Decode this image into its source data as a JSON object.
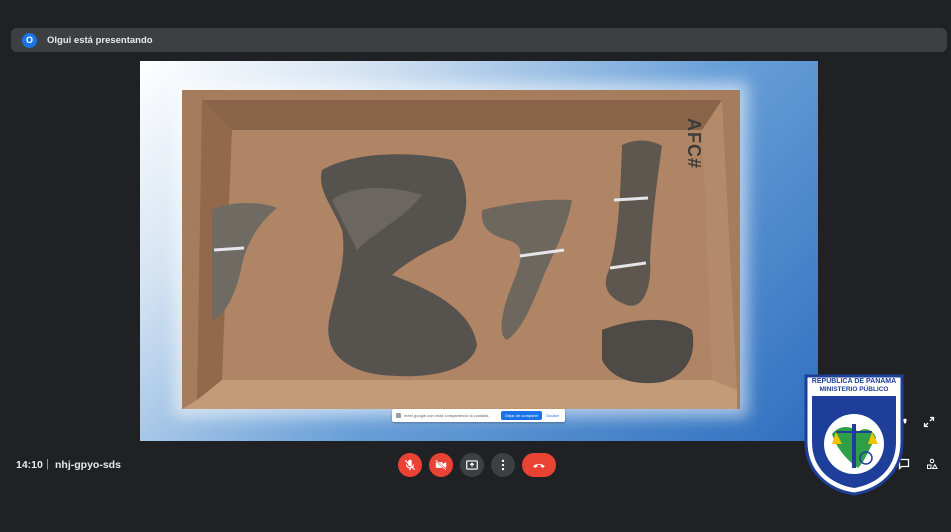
{
  "banner": {
    "avatar_letter": "O",
    "presenting_text": "Olgui está presentando"
  },
  "share_chip": {
    "text": "meet.google.com está compartiendo tu pantalla.",
    "stop_label": "Dejar de compartir",
    "hide_label": "Ocultar"
  },
  "photo": {
    "box_label": "AFC#"
  },
  "meeting": {
    "time": "14:10",
    "separator": "|",
    "code": "nhj-gpyo-sds"
  },
  "controls": {
    "mic": "mic-off-icon",
    "camera": "camera-off-icon",
    "present": "present-icon",
    "more": "more-vert-icon",
    "end_call": "call-end-icon"
  },
  "logo": {
    "line1": "REPÚBLICA DE PANAMÁ",
    "line2": "MINISTERIO PÚBLICO",
    "ring_text": "INSTITUTO DE MEDICINA LEGAL Y CIENCIAS FORENSES"
  },
  "colors": {
    "background": "#202124",
    "banner": "#3c4043",
    "accent": "#1a73e8",
    "end_call": "#ea4335"
  }
}
